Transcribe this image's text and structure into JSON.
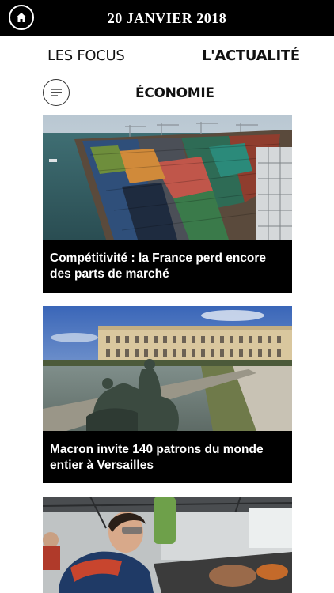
{
  "header": {
    "date": "20 JANVIER 2018",
    "home_icon": "home-icon"
  },
  "tabs": [
    {
      "label": "LES FOCUS",
      "active": false
    },
    {
      "label": "L'ACTUALITÉ",
      "active": true
    }
  ],
  "section": {
    "title": "ÉCONOMIE",
    "menu_icon": "menu-lines-icon"
  },
  "articles": [
    {
      "title": "Compétitivité : la France perd encore des parts de marché",
      "image": "container-port-photo"
    },
    {
      "title": "Macron invite 140 patrons du monde entier à Versailles",
      "image": "versailles-palace-photo"
    },
    {
      "title": "",
      "image": "industrial-workers-photo"
    }
  ]
}
